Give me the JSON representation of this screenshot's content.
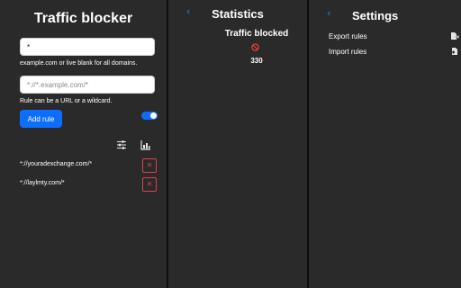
{
  "blocker": {
    "title": "Traffic blocker",
    "domain_input_value": "*",
    "domain_help": "example.com or live blank for all domains.",
    "rule_placeholder": "*://*.example.com/*",
    "rule_help": "Rule can be a URL or a wildcard.",
    "add_rule_label": "Add rule",
    "toggle_on": true,
    "rules": [
      {
        "text": "*://youradexchange.com/*"
      },
      {
        "text": "*://laylmty.com/*"
      }
    ],
    "delete_glyph": "✕"
  },
  "statistics": {
    "back_glyph": "‹",
    "title": "Statistics",
    "label": "Traffic blocked",
    "value": "330"
  },
  "settings": {
    "back_glyph": "‹",
    "title": "Settings",
    "items": [
      {
        "label": "Export rules",
        "icon": "export-icon"
      },
      {
        "label": "Import rules",
        "icon": "import-icon"
      }
    ]
  },
  "colors": {
    "background": "#2a2a2a",
    "accent": "#0d6efd",
    "back_arrow": "#2f7dff",
    "danger": "#d9434b",
    "blocked_icon": "#ff3b3b"
  }
}
